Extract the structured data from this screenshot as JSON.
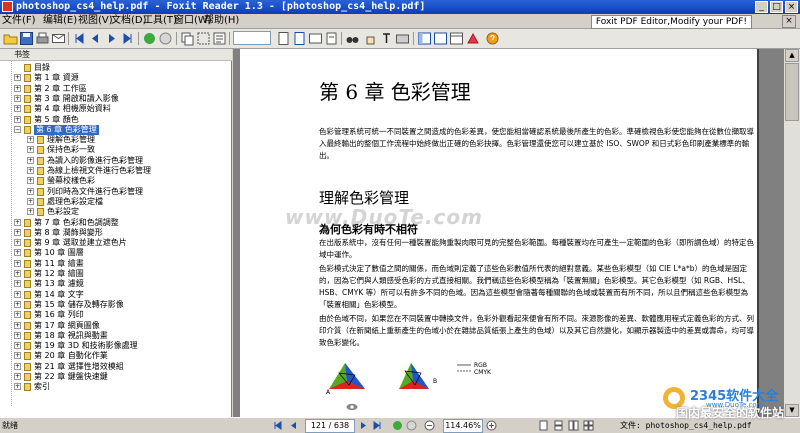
{
  "window": {
    "title": "photoshop_cs4_help.pdf - Foxit Reader 1.3 - [photoshop_cs4_help.pdf]",
    "min": "_",
    "max": "□",
    "close": "×"
  },
  "menu": {
    "items": [
      "文件(F)",
      "编辑(E)",
      "视图(V)",
      "文档(D)",
      "工具(T)",
      "窗口(W)",
      "帮助(H)"
    ],
    "ad": "Foxit PDF Editor,Modify your PDF!",
    "close": "×"
  },
  "bookmarks": {
    "header": "书签",
    "items": [
      {
        "label": "目錄",
        "exp": ""
      },
      {
        "label": "第 1 章 資源",
        "exp": "+"
      },
      {
        "label": "第 2 章 工作區",
        "exp": "+"
      },
      {
        "label": "第 3 章 開啟和讀入影像",
        "exp": "+"
      },
      {
        "label": "第 4 章 相機原始資料",
        "exp": "+"
      },
      {
        "label": "第 5 章 顏色",
        "exp": "+"
      },
      {
        "label": "第 6 章 色彩管理",
        "exp": "−",
        "selected": true
      },
      {
        "label": "理解色彩管理",
        "exp": "+",
        "indent": 1
      },
      {
        "label": "保持色彩一致",
        "exp": "+",
        "indent": 1
      },
      {
        "label": "為讀入的影像進行色彩管理",
        "exp": "+",
        "indent": 1
      },
      {
        "label": "為線上檢視文件進行色彩管理",
        "exp": "+",
        "indent": 1
      },
      {
        "label": "螢幕校樣色彩",
        "exp": "+",
        "indent": 1
      },
      {
        "label": "列印時為文件進行色彩管理",
        "exp": "+",
        "indent": 1
      },
      {
        "label": "處理色彩設定檔",
        "exp": "+",
        "indent": 1
      },
      {
        "label": "色彩設定",
        "exp": "+",
        "indent": 1
      },
      {
        "label": "第 7 章 色彩和色調調整",
        "exp": "+"
      },
      {
        "label": "第 8 章 潤飾與變形",
        "exp": "+"
      },
      {
        "label": "第 9 章 選取並建立遮色片",
        "exp": "+"
      },
      {
        "label": "第 10 章 圖層",
        "exp": "+"
      },
      {
        "label": "第 11 章 繪畫",
        "exp": "+"
      },
      {
        "label": "第 12 章 繪圖",
        "exp": "+"
      },
      {
        "label": "第 13 章 濾鏡",
        "exp": "+"
      },
      {
        "label": "第 14 章 文字",
        "exp": "+"
      },
      {
        "label": "第 15 章 儲存及轉存影像",
        "exp": "+"
      },
      {
        "label": "第 16 章 列印",
        "exp": "+"
      },
      {
        "label": "第 17 章 網頁圖像",
        "exp": "+"
      },
      {
        "label": "第 18 章 視訊與動畫",
        "exp": "+"
      },
      {
        "label": "第 19 章 3D 和技術影像處理",
        "exp": "+"
      },
      {
        "label": "第 20 章 自動化作業",
        "exp": "+"
      },
      {
        "label": "第 21 章 選擇性增效模組",
        "exp": "+"
      },
      {
        "label": "第 22 章 鍵盤快速鍵",
        "exp": "+"
      },
      {
        "label": "索引",
        "exp": "+"
      }
    ]
  },
  "document": {
    "chapter": "第 6 章 色彩管理",
    "intro": "色彩管理系統可統一不同裝置之間造成的色彩差異，使您能相當確認系統最後所產生的色彩。準確檢視色彩使您能夠在從數位擷取導入最終輸出的整個工作流程中始終做出正確的色彩抉擇。色彩管理還使您可以建立基於 ISO、SWOP 和日式彩色印刷產業標準的輸出。",
    "section": "理解色彩管理",
    "subsection": "為何色彩有時不相符",
    "p1": "在出版系統中，沒有任何一種裝置能夠重製肉眼可見的完整色彩範圍。每種裝置均在可產生一定範圍的色彩（即所謂色域）的特定色域中運作。",
    "p2": "色彩模式決定了數值之間的關係，而色域則定義了這些色彩數值所代表的絕對意義。某些色彩模型（如 CIE L*a*b）的色域是固定的，因為它們與人類感受色彩的方式直接相關。我們稱這些色彩模型稱為「裝置無關」色彩模型。其它色彩模型（如 RGB、HSL、HSB、CMYK 等）所可以有許多不同的色域。因為這些模型會隨著每種關聯的色域或裝置而有所不同，所以且們稱這些色彩模型為「裝置相關」色彩模型。",
    "p3": "由於色域不同，如果您在不同裝置中轉換文件，色彩外觀看起來便會有所不同。來源影像的差異、軟體應用程式定義色彩的方式、列印介質（在新聞紙上重新產生的色域小於在雜誌品質紙張上產生的色域）以及其它自然變化，如顯示器製造中的差異或壽命，均可導致色彩變化。",
    "fig_a": "A",
    "fig_b": "B",
    "legend_rgb": "RGB",
    "legend_cmyk": "CMYK",
    "watermark": "www.DuoTe.com"
  },
  "status": {
    "ready": "就绪",
    "page": "121 / 638",
    "zoom": "114.46%",
    "file": "文件: photoshop_cs4_help.pdf",
    "wm_logo": "2345软件大全",
    "wm_url": "www.DuoTe.com",
    "wm_slogan": "国内最安全的软件站"
  }
}
